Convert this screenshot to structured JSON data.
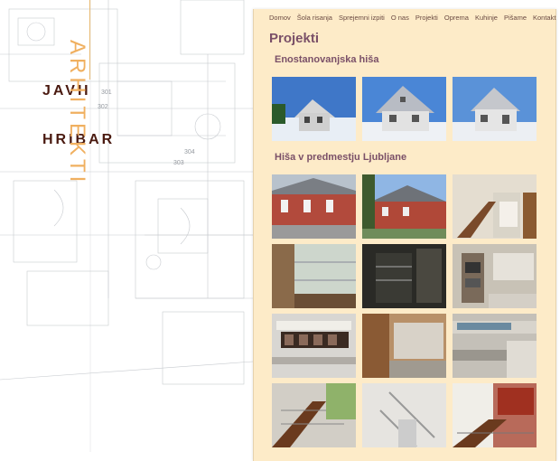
{
  "brand": {
    "name_1": "JAVH",
    "name_2": "HRIBAR",
    "vertical": "ARHITEKTI",
    "vertical_color": "#f0b060"
  },
  "nav": {
    "items": [
      "Domov",
      "Šola risanja",
      "Sprejemni izpiti",
      "O nas",
      "Projekti",
      "Oprema",
      "Kuhinje",
      "Pišame",
      "Kontakt"
    ]
  },
  "page": {
    "title": "Projekti"
  },
  "sections": [
    {
      "title": "Enostanovanjska hiša"
    },
    {
      "title": "Hiša v predmestju Ljubljane"
    }
  ],
  "colors": {
    "panel_bg": "#fdebc8",
    "title_color": "#7a5068",
    "brand_color": "#4a1a10"
  }
}
